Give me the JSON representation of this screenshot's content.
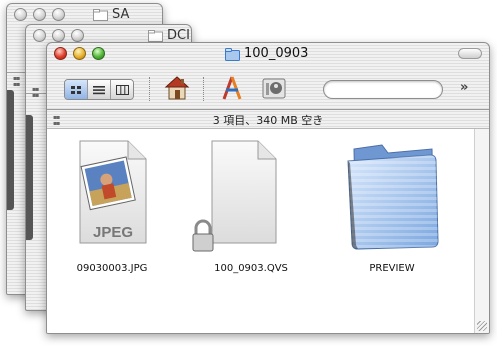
{
  "windows": {
    "back": {
      "title": "SA"
    },
    "middle": {
      "title": "DCIM"
    },
    "front": {
      "title": "100_0903",
      "status": "3 項目、340 MB 空き",
      "search": {
        "value": "",
        "placeholder": ""
      }
    }
  },
  "toolbar": {
    "view_modes": [
      "icon-view",
      "list-view",
      "column-view"
    ],
    "active_view": "icon-view",
    "tools": [
      "home-icon",
      "applications-icon",
      "utilities-icon"
    ],
    "overflow_glyph": "»"
  },
  "files": [
    {
      "name": "09030003.JPG",
      "kind": "JPEG",
      "icon": "jpeg-document-icon"
    },
    {
      "name": "100_0903.QVS",
      "icon": "locked-document-icon",
      "locked": true
    },
    {
      "name": "PREVIEW",
      "icon": "folder-icon"
    }
  ],
  "colors": {
    "folder_blue": "#9cc0ea",
    "accent_blue": "#3b79c9"
  }
}
